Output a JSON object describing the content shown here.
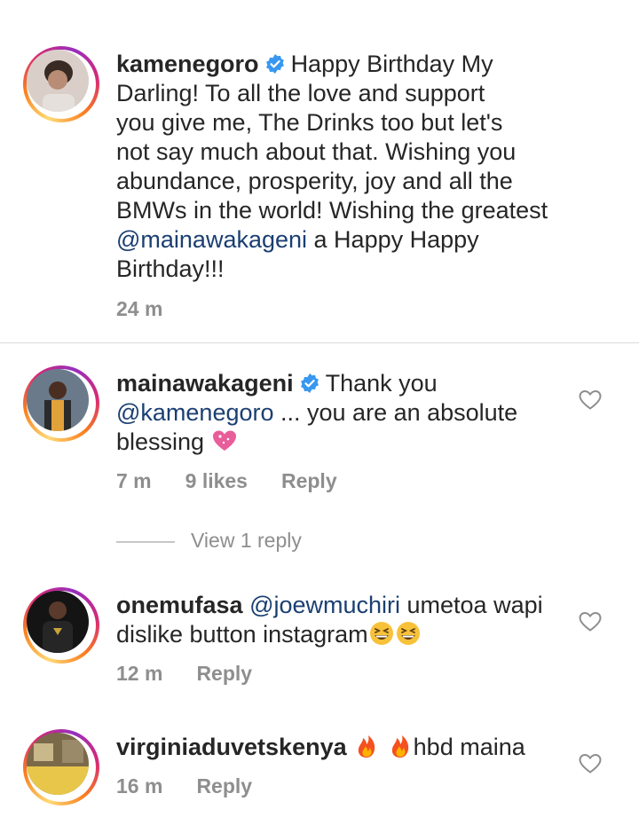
{
  "comments": [
    {
      "username": "kamenegoro",
      "verified": true,
      "lines": [
        "Happy Birthday My",
        "Darling! To all the love and support",
        "you give me, The Drinks too but let's",
        "not say much about that. Wishing you",
        "abundance, prosperity, joy and all the",
        "BMWs in the world! Wishing the greatest"
      ],
      "mention": "@mainawakageni",
      "after_mention": " a Happy Happy",
      "last_line": "Birthday!!!",
      "time": "24 m"
    },
    {
      "username": "mainawakageni",
      "verified": true,
      "text_first": "Thank you",
      "mention": "@kamenegoro",
      "text_second": " ... you are an absolute",
      "text_third": "blessing",
      "emoji": "sparkling-heart",
      "time": "7 m",
      "likes": "9 likes",
      "reply": "Reply",
      "view_replies": "View 1 reply"
    },
    {
      "username": "onemufasa",
      "mention": "@joewmuchiri",
      "text": " umetoa wapi",
      "text_second": "dislike button instagram",
      "emoji": "grinning-squinting-face",
      "time": "12 m",
      "reply": "Reply"
    },
    {
      "username": "virginiaduvetskenya",
      "emoji": "fire",
      "text": "hbd maina",
      "time": "16 m",
      "reply": "Reply"
    }
  ],
  "colors": {
    "text": "#262626",
    "mention": "#1b3f72",
    "meta": "#8e8e8e",
    "verified": "#3897f0"
  }
}
